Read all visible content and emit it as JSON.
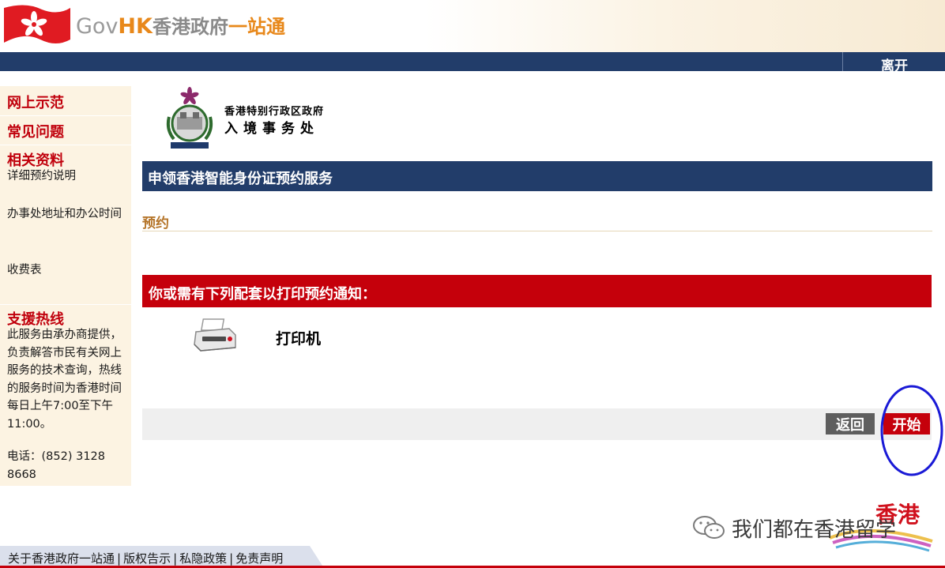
{
  "header": {
    "logo_gov": "Gov",
    "logo_hk": "HK",
    "logo_cn_a": "香港政府",
    "logo_cn_b": "一站通"
  },
  "nav": {
    "exit_label": "离开"
  },
  "sidebar": {
    "demo": "网上示范",
    "faq": "常见问题",
    "related_title": "相关资料",
    "related_links": [
      "详细预约说明",
      "办事处地址和办公时间",
      "收费表"
    ],
    "hotline_title": "支援热线",
    "hotline_text": "此服务由承办商提供，负责解答市民有关网上服务的技术查询，热线的服务时间为香港时间每日上午7:00至下午11:00。",
    "phone": "电话：(852) 3128 8668"
  },
  "department": {
    "line1": "香港特别行政区政府",
    "line2": "入境事务处"
  },
  "service_title": "申领香港智能身份证预约服务",
  "section_label": "预约",
  "notice": "你或需有下列配套以打印预约通知：",
  "printer_label": "打印机",
  "buttons": {
    "back": "返回",
    "start": "开始"
  },
  "footer": {
    "links": [
      "关于香港政府一站通",
      "版权告示",
      "私隐政策",
      "免责声明"
    ],
    "separator": "|"
  },
  "watermark": {
    "text": "我们都在香港留学",
    "logo_text": "香港"
  },
  "colors": {
    "navy": "#223d6a",
    "red": "#c5000b",
    "sidebar_bg": "#fcf3e2",
    "label_brown": "#b5752a",
    "annotation_blue": "#1a1ad6"
  }
}
